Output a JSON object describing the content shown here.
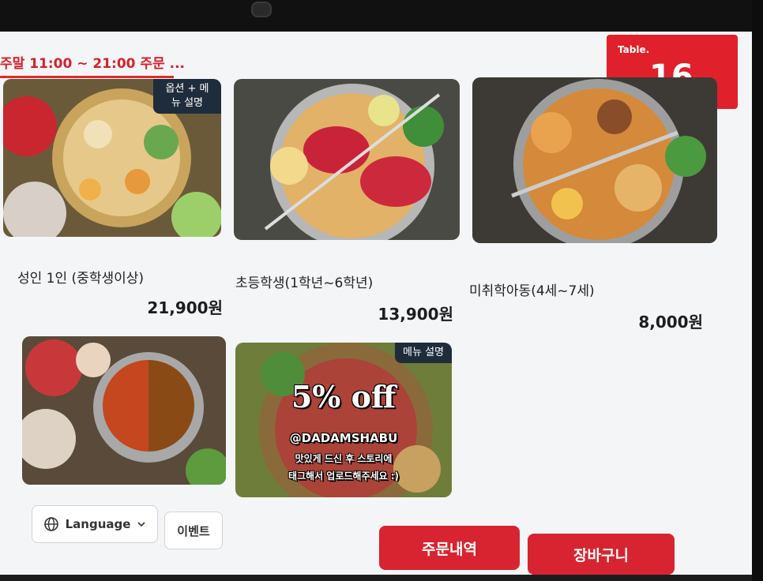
{
  "header": {
    "hours": "주말 11:00 ~ 21:00 주문 ...",
    "table_label": "Table.",
    "table_number": "16"
  },
  "menu": [
    {
      "tag": "옵션 + 메뉴 설명",
      "name": "성인 1인 (중학생이상)",
      "price": "21,900원"
    },
    {
      "name": "초등학생(1학년~6학년)",
      "price": "13,900원"
    },
    {
      "name": "미취학아동(4세~7세)",
      "price": "8,000원"
    }
  ],
  "promo": {
    "tag": "메뉴 설명",
    "headline": "5% off",
    "handle": "@DADAMSHABU",
    "line1": "맛있게 드신 후 스토리에",
    "line2": "태그해서 업로드해주세요 :)"
  },
  "footer": {
    "language_label": "Language",
    "event_label": "이벤트",
    "order_history_label": "주문내역",
    "cart_label": "장바구니"
  },
  "colors": {
    "accent": "#e0202a",
    "tag_bg": "#1f2c3b",
    "screen_bg": "#f4f5f7"
  }
}
